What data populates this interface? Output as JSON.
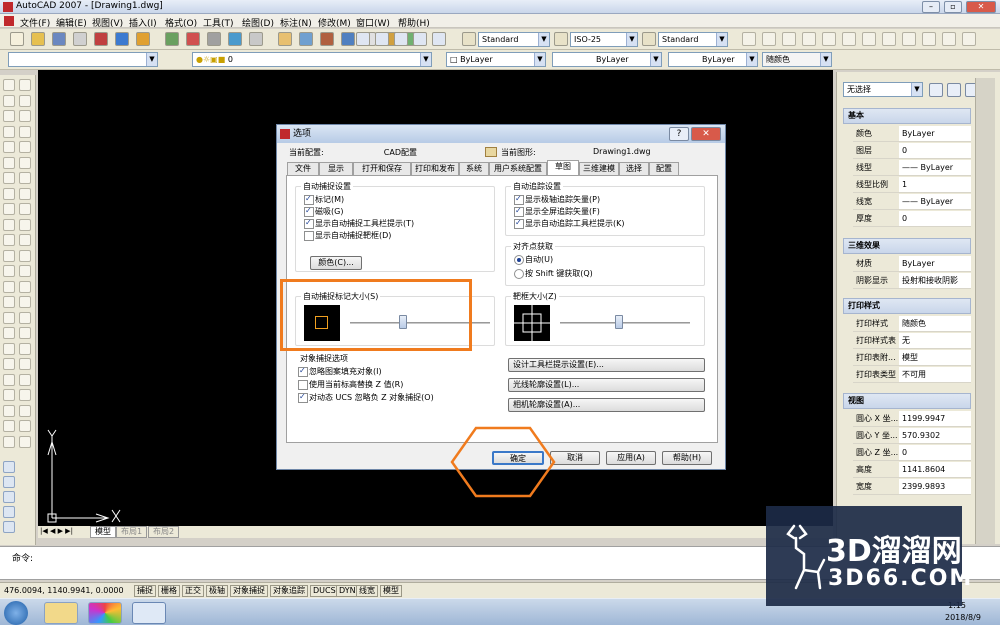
{
  "window": {
    "title": "AutoCAD 2007 - [Drawing1.dwg]"
  },
  "menu": [
    "文件(F)",
    "编辑(E)",
    "视图(V)",
    "插入(I)",
    "格式(O)",
    "工具(T)",
    "绘图(D)",
    "标注(N)",
    "修改(M)",
    "窗口(W)",
    "帮助(H)"
  ],
  "toolbar": {
    "text_style": "Standard",
    "dim_style": "ISO-25",
    "table_style": "Standard",
    "layer": "0",
    "color": "ByLayer",
    "linetype": "ByLayer",
    "lineweight": "ByLayer",
    "plotstyle": "随颜色"
  },
  "properties": {
    "selection": "无选择",
    "groups": {
      "basic": "基本",
      "threed": "三维效果",
      "print": "打印样式",
      "view": "视图"
    },
    "basic_rows": [
      {
        "key": "颜色",
        "value": "ByLayer"
      },
      {
        "key": "图层",
        "value": "0"
      },
      {
        "key": "线型",
        "value": "—— ByLayer"
      },
      {
        "key": "线型比例",
        "value": "1"
      },
      {
        "key": "线宽",
        "value": "—— ByLayer"
      },
      {
        "key": "厚度",
        "value": "0"
      }
    ],
    "threed_rows": [
      {
        "key": "材质",
        "value": "ByLayer"
      },
      {
        "key": "阴影显示",
        "value": "投射和接收阴影"
      }
    ],
    "print_rows": [
      {
        "key": "打印样式",
        "value": "随颜色"
      },
      {
        "key": "打印样式表",
        "value": "无"
      },
      {
        "key": "打印表附...",
        "value": "模型"
      },
      {
        "key": "打印表类型",
        "value": "不可用"
      }
    ],
    "view_rows": [
      {
        "key": "圆心 X 坐...",
        "value": "1199.9947"
      },
      {
        "key": "圆心 Y 坐...",
        "value": "570.9302"
      },
      {
        "key": "圆心 Z 坐...",
        "value": "0"
      },
      {
        "key": "高度",
        "value": "1141.8604"
      },
      {
        "key": "宽度",
        "value": "2399.9893"
      }
    ]
  },
  "layout_tabs": [
    "模型",
    "布局1",
    "布局2"
  ],
  "command": {
    "prompt": "命令:"
  },
  "status": {
    "coords": "476.0094, 1140.9941, 0.0000",
    "buttons": [
      "捕捉",
      "栅格",
      "正交",
      "极轴",
      "对象捕捉",
      "对象追踪",
      "DUCS",
      "DYN",
      "线宽",
      "模型"
    ]
  },
  "taskbar": {
    "time": "1:15",
    "date": "2018/8/9"
  },
  "watermark": {
    "brand_cn": "3D溜溜网",
    "brand_en": "3D66.COM"
  },
  "dialog": {
    "title": "选项",
    "current_profile_label": "当前配置:",
    "current_profile_value": "CAD配置",
    "current_drawing_label": "当前图形:",
    "current_drawing_value": "Drawing1.dwg",
    "tabs": [
      "文件",
      "显示",
      "打开和保存",
      "打印和发布",
      "系统",
      "用户系统配置",
      "草图",
      "三维建模",
      "选择",
      "配置"
    ],
    "autosnap": {
      "title": "自动捕捉设置",
      "items": [
        {
          "label": "标记(M)",
          "checked": true
        },
        {
          "label": "磁吸(G)",
          "checked": true
        },
        {
          "label": "显示自动捕捉工具栏提示(T)",
          "checked": true
        },
        {
          "label": "显示自动捕捉靶框(D)",
          "checked": false
        }
      ],
      "color_button": "颜色(C)..."
    },
    "autotrack": {
      "title": "自动追踪设置",
      "items": [
        {
          "label": "显示极轴追踪矢量(P)",
          "checked": true
        },
        {
          "label": "显示全屏追踪矢量(F)",
          "checked": true
        },
        {
          "label": "显示自动追踪工具栏提示(K)",
          "checked": true
        }
      ]
    },
    "alignment": {
      "title": "对齐点获取",
      "options": [
        {
          "label": "自动(U)",
          "selected": true
        },
        {
          "label": "按 Shift 键获取(Q)",
          "selected": false
        }
      ]
    },
    "marker_size": {
      "title": "自动捕捉标记大小(S)",
      "level": 0.38
    },
    "aperture_size": {
      "title": "靶框大小(Z)",
      "level": 0.45
    },
    "osnap": {
      "title": "对象捕捉选项",
      "items": [
        {
          "label": "忽略图案填充对象(I)",
          "checked": true
        },
        {
          "label": "使用当前标高替换 Z 值(R)",
          "checked": false
        },
        {
          "label": "对动态 UCS 忽略负 Z 对象捕捉(O)",
          "checked": true
        }
      ]
    },
    "settings_buttons": [
      "设计工具栏提示设置(E)...",
      "光线轮廓设置(L)...",
      "相机轮廓设置(A)..."
    ],
    "buttons": {
      "ok": "确定",
      "cancel": "取消",
      "apply": "应用(A)",
      "help": "帮助(H)"
    }
  },
  "colors": {
    "accent_annotation": "#f07b1e",
    "canvas": "#000000"
  }
}
